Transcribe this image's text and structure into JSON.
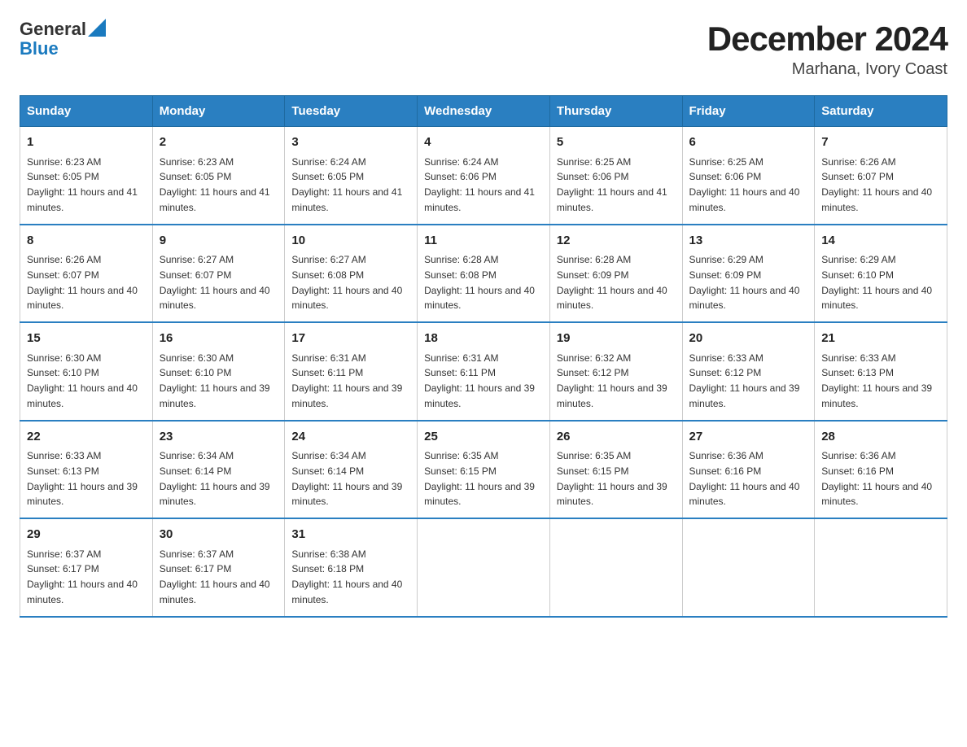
{
  "header": {
    "logo_line1": "General",
    "logo_line2": "Blue",
    "title": "December 2024",
    "subtitle": "Marhana, Ivory Coast"
  },
  "days_of_week": [
    "Sunday",
    "Monday",
    "Tuesday",
    "Wednesday",
    "Thursday",
    "Friday",
    "Saturday"
  ],
  "weeks": [
    [
      {
        "day": "1",
        "sunrise": "6:23 AM",
        "sunset": "6:05 PM",
        "daylight": "11 hours and 41 minutes."
      },
      {
        "day": "2",
        "sunrise": "6:23 AM",
        "sunset": "6:05 PM",
        "daylight": "11 hours and 41 minutes."
      },
      {
        "day": "3",
        "sunrise": "6:24 AM",
        "sunset": "6:05 PM",
        "daylight": "11 hours and 41 minutes."
      },
      {
        "day": "4",
        "sunrise": "6:24 AM",
        "sunset": "6:06 PM",
        "daylight": "11 hours and 41 minutes."
      },
      {
        "day": "5",
        "sunrise": "6:25 AM",
        "sunset": "6:06 PM",
        "daylight": "11 hours and 41 minutes."
      },
      {
        "day": "6",
        "sunrise": "6:25 AM",
        "sunset": "6:06 PM",
        "daylight": "11 hours and 40 minutes."
      },
      {
        "day": "7",
        "sunrise": "6:26 AM",
        "sunset": "6:07 PM",
        "daylight": "11 hours and 40 minutes."
      }
    ],
    [
      {
        "day": "8",
        "sunrise": "6:26 AM",
        "sunset": "6:07 PM",
        "daylight": "11 hours and 40 minutes."
      },
      {
        "day": "9",
        "sunrise": "6:27 AM",
        "sunset": "6:07 PM",
        "daylight": "11 hours and 40 minutes."
      },
      {
        "day": "10",
        "sunrise": "6:27 AM",
        "sunset": "6:08 PM",
        "daylight": "11 hours and 40 minutes."
      },
      {
        "day": "11",
        "sunrise": "6:28 AM",
        "sunset": "6:08 PM",
        "daylight": "11 hours and 40 minutes."
      },
      {
        "day": "12",
        "sunrise": "6:28 AM",
        "sunset": "6:09 PM",
        "daylight": "11 hours and 40 minutes."
      },
      {
        "day": "13",
        "sunrise": "6:29 AM",
        "sunset": "6:09 PM",
        "daylight": "11 hours and 40 minutes."
      },
      {
        "day": "14",
        "sunrise": "6:29 AM",
        "sunset": "6:10 PM",
        "daylight": "11 hours and 40 minutes."
      }
    ],
    [
      {
        "day": "15",
        "sunrise": "6:30 AM",
        "sunset": "6:10 PM",
        "daylight": "11 hours and 40 minutes."
      },
      {
        "day": "16",
        "sunrise": "6:30 AM",
        "sunset": "6:10 PM",
        "daylight": "11 hours and 39 minutes."
      },
      {
        "day": "17",
        "sunrise": "6:31 AM",
        "sunset": "6:11 PM",
        "daylight": "11 hours and 39 minutes."
      },
      {
        "day": "18",
        "sunrise": "6:31 AM",
        "sunset": "6:11 PM",
        "daylight": "11 hours and 39 minutes."
      },
      {
        "day": "19",
        "sunrise": "6:32 AM",
        "sunset": "6:12 PM",
        "daylight": "11 hours and 39 minutes."
      },
      {
        "day": "20",
        "sunrise": "6:33 AM",
        "sunset": "6:12 PM",
        "daylight": "11 hours and 39 minutes."
      },
      {
        "day": "21",
        "sunrise": "6:33 AM",
        "sunset": "6:13 PM",
        "daylight": "11 hours and 39 minutes."
      }
    ],
    [
      {
        "day": "22",
        "sunrise": "6:33 AM",
        "sunset": "6:13 PM",
        "daylight": "11 hours and 39 minutes."
      },
      {
        "day": "23",
        "sunrise": "6:34 AM",
        "sunset": "6:14 PM",
        "daylight": "11 hours and 39 minutes."
      },
      {
        "day": "24",
        "sunrise": "6:34 AM",
        "sunset": "6:14 PM",
        "daylight": "11 hours and 39 minutes."
      },
      {
        "day": "25",
        "sunrise": "6:35 AM",
        "sunset": "6:15 PM",
        "daylight": "11 hours and 39 minutes."
      },
      {
        "day": "26",
        "sunrise": "6:35 AM",
        "sunset": "6:15 PM",
        "daylight": "11 hours and 39 minutes."
      },
      {
        "day": "27",
        "sunrise": "6:36 AM",
        "sunset": "6:16 PM",
        "daylight": "11 hours and 40 minutes."
      },
      {
        "day": "28",
        "sunrise": "6:36 AM",
        "sunset": "6:16 PM",
        "daylight": "11 hours and 40 minutes."
      }
    ],
    [
      {
        "day": "29",
        "sunrise": "6:37 AM",
        "sunset": "6:17 PM",
        "daylight": "11 hours and 40 minutes."
      },
      {
        "day": "30",
        "sunrise": "6:37 AM",
        "sunset": "6:17 PM",
        "daylight": "11 hours and 40 minutes."
      },
      {
        "day": "31",
        "sunrise": "6:38 AM",
        "sunset": "6:18 PM",
        "daylight": "11 hours and 40 minutes."
      },
      null,
      null,
      null,
      null
    ]
  ]
}
